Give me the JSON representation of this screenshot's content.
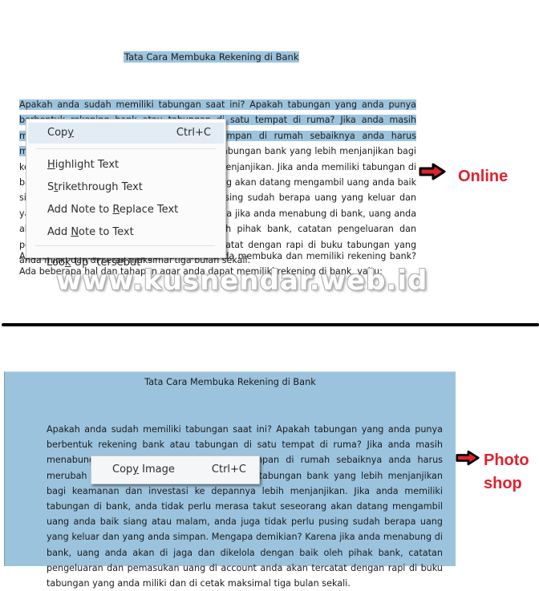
{
  "online": {
    "doc_title": "Tata Cara Membuka Rekening di Bank",
    "paragraph1_selected": "Apakah anda sudah memiliki tabungan saat ini? Apakah tabungan yang anda punya berbentuk rekening bank atau tabungan di satu tempat di ruma? Jika anda masih menabung dengan cara lama yaitu menyimpan di rumah sebaiknya anda harus merubah kebiasaan tersebut",
    "paragraph1_rest": " dan beralih ke tabungan bank yang lebih menjanjikan bagi keamanan dan investasi ke depannya lebih menjanjikan. Jika anda memiliki tabungan di bank, anda tidak perlu merasa takut seseorang akan datang mengambil uang anda baik siang atau malam, anda juga tidak perlu pusing sudah berapa uang yang keluar dan yang anda simpan. Mengapa demikian? Karena jika anda menabung di bank, uang anda akan di jaga dan dikelola dengan baik oleh pihak bank, catatan pengeluaran dan pemasukan uang di account anda akan tercatat dengan rapi di buku tabungan yang anda miliki dan di cetak maksimal tiga bulan sekali.",
    "paragraph2": "Apakah anda sudah tahu bagaimana cara anda membuka dan memiliki rekening bank? Ada beberapa hal dan tahapan agar anda dapat memiliki rekening di bank, yaitu:",
    "context_menu": {
      "copy": {
        "pre": "Cop",
        "key": "y",
        "post": "",
        "shortcut": "Ctrl+C"
      },
      "highlight": {
        "pre": "",
        "key": "H",
        "post": "ighlight Text"
      },
      "strikethrough": {
        "pre": "S",
        "key": "t",
        "post": "rikethrough Text"
      },
      "note_replace": {
        "pre": "Add Note to ",
        "key": "R",
        "post": "eplace Text"
      },
      "note_text": {
        "pre": "Add ",
        "key": "N",
        "post": "ote to Text"
      },
      "lookup": {
        "pre": "Loo",
        "key": "k",
        "post": " Up \"tersebut\""
      }
    },
    "label": "Online",
    "arrow_icon": "right-arrow-icon"
  },
  "watermark": "www.kusnendar.web.id",
  "photoshop": {
    "doc_title": "Tata Cara Membuka Rekening di Bank",
    "paragraph": "Apakah anda sudah memiliki tabungan saat ini? Apakah tabungan yang anda punya berbentuk rekening bank atau tabungan di satu tempat di ruma? Jika anda masih menabung dengan cara lama yaitu menyimpan di rumah sebaiknya anda harus merubah kebiasaan tersebut dan beralih ke tabungan bank yang lebih menjanjikan bagi keamanan dan investasi ke depannya lebih menjanjikan. Jika anda memiliki tabungan di bank, anda tidak perlu merasa takut seseorang akan datang mengambil uang anda baik siang atau malam, anda juga tidak perlu pusing sudah berapa uang yang keluar dan yang anda simpan. Mengapa demikian? Karena jika anda menabung di bank, uang anda akan di jaga dan dikelola dengan baik oleh pihak bank, catatan pengeluaran dan pemasukan uang di account anda akan tercatat dengan rapi di buku tabungan yang anda miliki dan di cetak maksimal tiga bulan sekali.",
    "context_menu": {
      "copy_image": {
        "pre": "Cop",
        "key": "y",
        "post": " Image",
        "shortcut": "Ctrl+C"
      }
    },
    "label_line1": "Photo",
    "label_line2": "shop",
    "arrow_icon": "right-arrow-icon"
  },
  "colors": {
    "selection": "#9cc3de",
    "label_red": "#e0222f",
    "menu_hover": "#e3ecf5"
  }
}
